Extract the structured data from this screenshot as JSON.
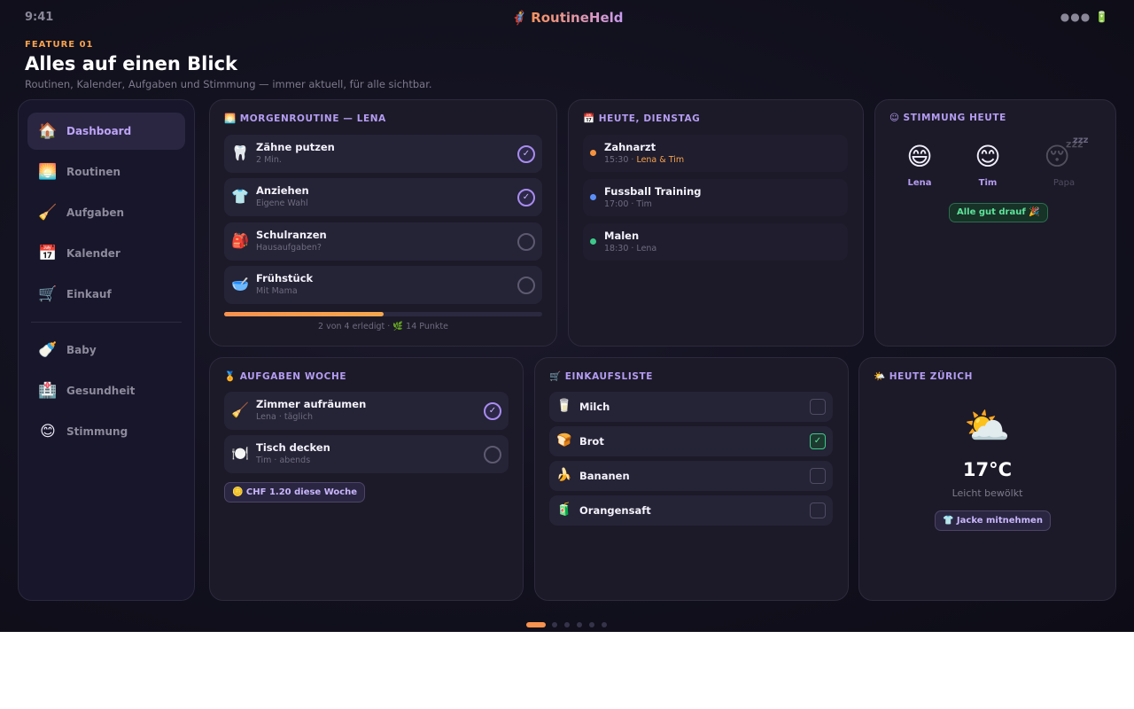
{
  "status": {
    "time": "9:41",
    "brand": "RoutineHeld",
    "brand_icon": "🦸",
    "signal": "●●●",
    "battery": "🔋"
  },
  "header": {
    "tag": "FEATURE 01",
    "title": "Alles auf einen Blick",
    "subtitle": "Routinen, Kalender, Aufgaben und Stimmung — immer aktuell, für alle sichtbar."
  },
  "sidebar": {
    "items": [
      {
        "icon": "🏠",
        "label": "Dashboard"
      },
      {
        "icon": "🌅",
        "label": "Routinen"
      },
      {
        "icon": "🧹",
        "label": "Aufgaben"
      },
      {
        "icon": "📅",
        "label": "Kalender"
      },
      {
        "icon": "🛒",
        "label": "Einkauf"
      },
      {
        "icon": "🍼",
        "label": "Baby"
      },
      {
        "icon": "🏥",
        "label": "Gesundheit"
      },
      {
        "icon": "😊",
        "label": "Stimmung"
      }
    ]
  },
  "routine": {
    "icon": "🌅",
    "title": "MORGENROUTINE — LENA",
    "items": [
      {
        "icon": "🦷",
        "name": "Zähne putzen",
        "sub": "2 Min.",
        "done": "✓"
      },
      {
        "icon": "👕",
        "name": "Anziehen",
        "sub": "Eigene Wahl",
        "done": "✓"
      },
      {
        "icon": "🎒",
        "name": "Schulranzen",
        "sub": "Hausaufgaben?",
        "done": ""
      },
      {
        "icon": "🥣",
        "name": "Frühstück",
        "sub": "Mit Mama",
        "done": ""
      }
    ],
    "progress": 0.5,
    "progress_text": "2 von 4 erledigt · 🌿 14 Punkte"
  },
  "calendar": {
    "icon": "📅",
    "title": "HEUTE, DIENSTAG",
    "events": [
      {
        "name": "Zahnarzt",
        "time": "15:30 · ",
        "who": "Lena & Tim",
        "color": "#f6923e"
      },
      {
        "name": "Fussball Training",
        "time": "17:00 · Tim",
        "who": "",
        "color": "#5b8ff7"
      },
      {
        "name": "Malen",
        "time": "18:30 · Lena",
        "who": "",
        "color": "#3ec98a"
      }
    ]
  },
  "mood": {
    "icon": "☺",
    "title": "STIMMUNG HEUTE",
    "people": [
      {
        "face": "😄",
        "name": "Lena"
      },
      {
        "face": "😊",
        "name": "Tim"
      },
      {
        "face": "😴",
        "name": "Papa",
        "zzz": "zzz"
      }
    ],
    "badge": "Alle gut drauf 🎉"
  },
  "tasks": {
    "icon": "🏅",
    "title": "AUFGABEN WOCHE",
    "items": [
      {
        "icon": "🧹",
        "name": "Zimmer aufräumen",
        "sub": "Lena · täglich",
        "done": "✓"
      },
      {
        "icon": "🍽️",
        "name": "Tisch decken",
        "sub": "Tim · abends",
        "done": ""
      }
    ],
    "chip": "🪙 CHF 1.20 diese Woche"
  },
  "shopping": {
    "icon": "🛒",
    "title": "EINKAUFSLISTE",
    "items": [
      {
        "icon": "🥛",
        "name": "Milch",
        "done": ""
      },
      {
        "icon": "🍞",
        "name": "Brot",
        "done": "✓"
      },
      {
        "icon": "🍌",
        "name": "Bananen",
        "done": ""
      },
      {
        "icon": "🧃",
        "name": "Orangensaft",
        "done": ""
      }
    ]
  },
  "weather": {
    "icon": "🌤️",
    "title": "HEUTE ZÜRICH",
    "big_icon": "⛅",
    "temp": "17°C",
    "desc": "Leicht bewölkt",
    "chip": "👕 Jacke mitnehmen"
  },
  "pagination": {
    "count": 6,
    "active": 0
  }
}
